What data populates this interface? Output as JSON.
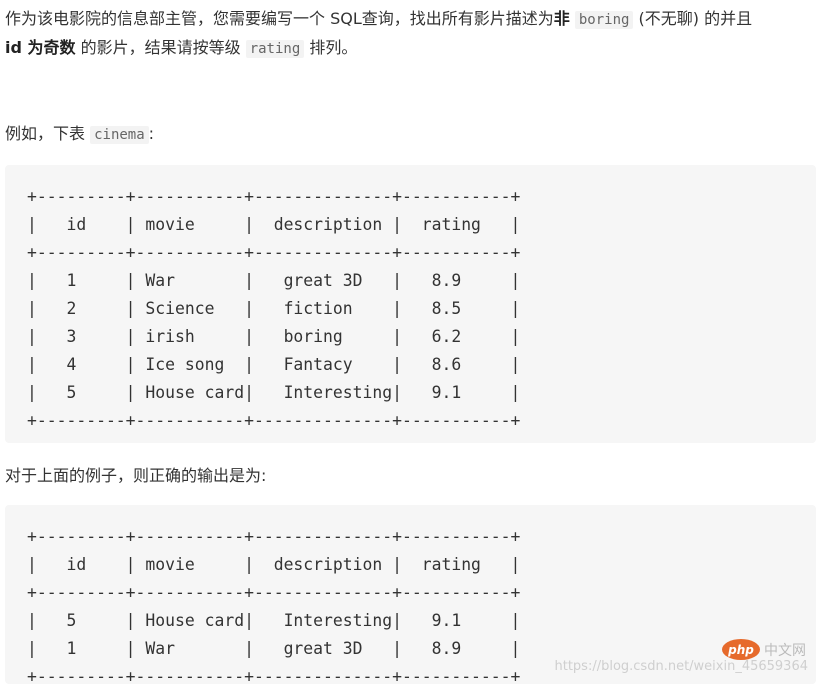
{
  "intro": {
    "part1": "作为该电影院的信息部主管，您需要编写一个 SQL查询，找出所有影片描述为",
    "bold1": "非",
    "code1": "boring",
    "part2": " (不无聊) 的并且",
    "bold2": "id 为奇数",
    "part3": " 的影片，结果请按等级 ",
    "code2": "rating",
    "part4": " 排列。"
  },
  "example_intro": {
    "prefix": "例如，下表 ",
    "code": "cinema",
    "suffix": ":"
  },
  "input_table": "+---------+-----------+--------------+-----------+\n|   id    | movie     |  description |  rating   |\n+---------+-----------+--------------+-----------+\n|   1     | War       |   great 3D   |   8.9     |\n|   2     | Science   |   fiction    |   8.5     |\n|   3     | irish     |   boring     |   6.2     |\n|   4     | Ice song  |   Fantacy    |   8.6     |\n|   5     | House card|   Interesting|   9.1     |\n+---------+-----------+--------------+-----------+",
  "output_intro": "对于上面的例子，则正确的输出是为:",
  "output_table": "+---------+-----------+--------------+-----------+\n|   id    | movie     |  description |  rating   |\n+---------+-----------+--------------+-----------+\n|   5     | House card|   Interesting|   9.1     |\n|   1     | War       |   great 3D   |   8.9     |\n+---------+-----------+--------------+-----------+",
  "watermark": "https://blog.csdn.net/weixin_45659364",
  "logo": {
    "mark": "php",
    "text": "中文网"
  }
}
